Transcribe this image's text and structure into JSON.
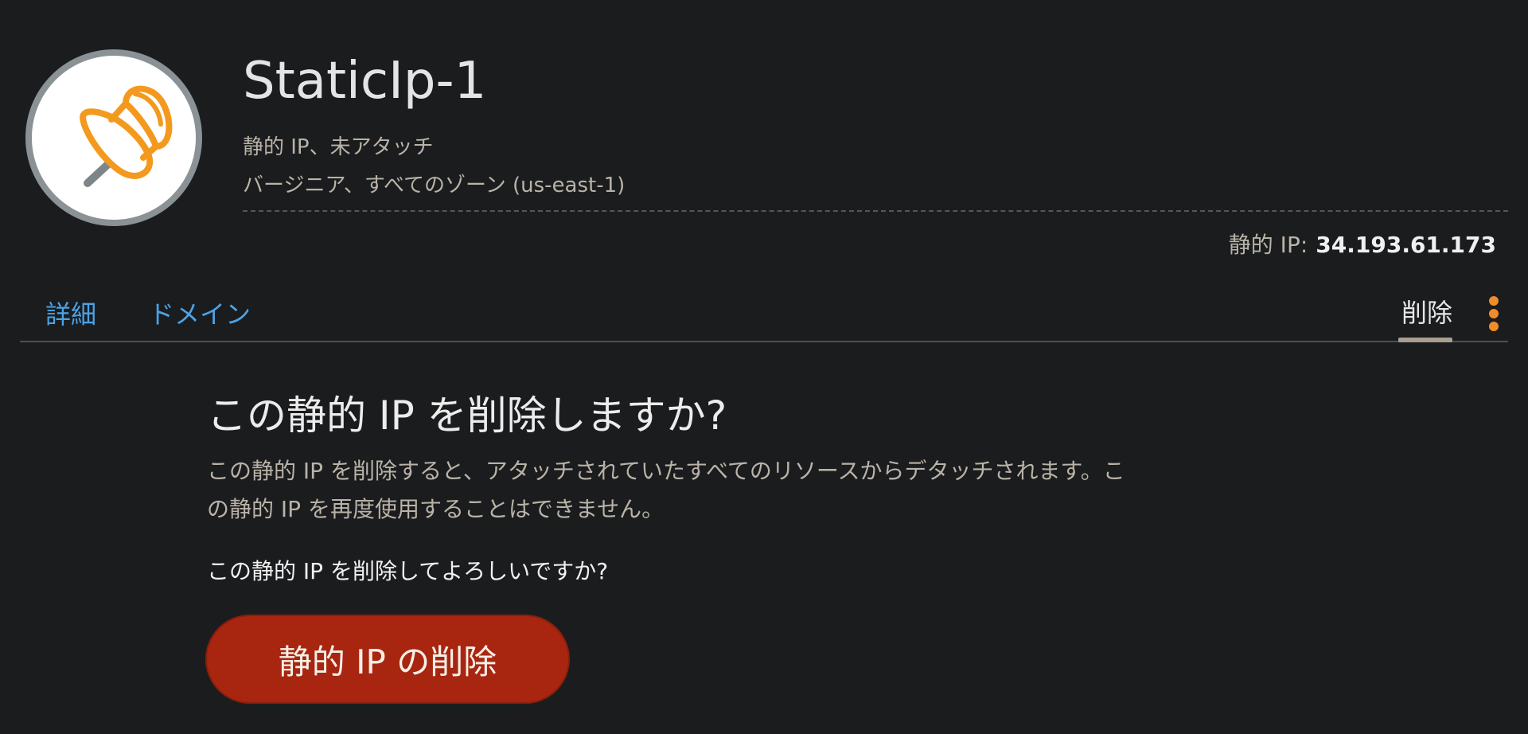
{
  "header": {
    "title": "StaticIp-1",
    "subtitle": "静的 IP、未アタッチ",
    "location": "バージニア、すべてのゾーン (us-east-1)",
    "static_ip_label": "静的 IP:",
    "static_ip_value": "34.193.61.173",
    "avatar_icon": "pushpin-icon"
  },
  "tabs": {
    "details": "詳細",
    "domains": "ドメイン",
    "delete": "削除",
    "active": "delete"
  },
  "content": {
    "heading": "この静的 IP を削除しますか?",
    "description": "この静的 IP を削除すると、アタッチされていたすべてのリソースからデタッチされます。この静的 IP を再度使用することはできません。",
    "confirm_question": "この静的 IP を削除してよろしいですか?",
    "delete_button": "静的 IP の削除"
  },
  "colors": {
    "background": "#1b1c1e",
    "link": "#4aa3e6",
    "accent": "#f08c2b",
    "danger_button": "#a8250f"
  }
}
